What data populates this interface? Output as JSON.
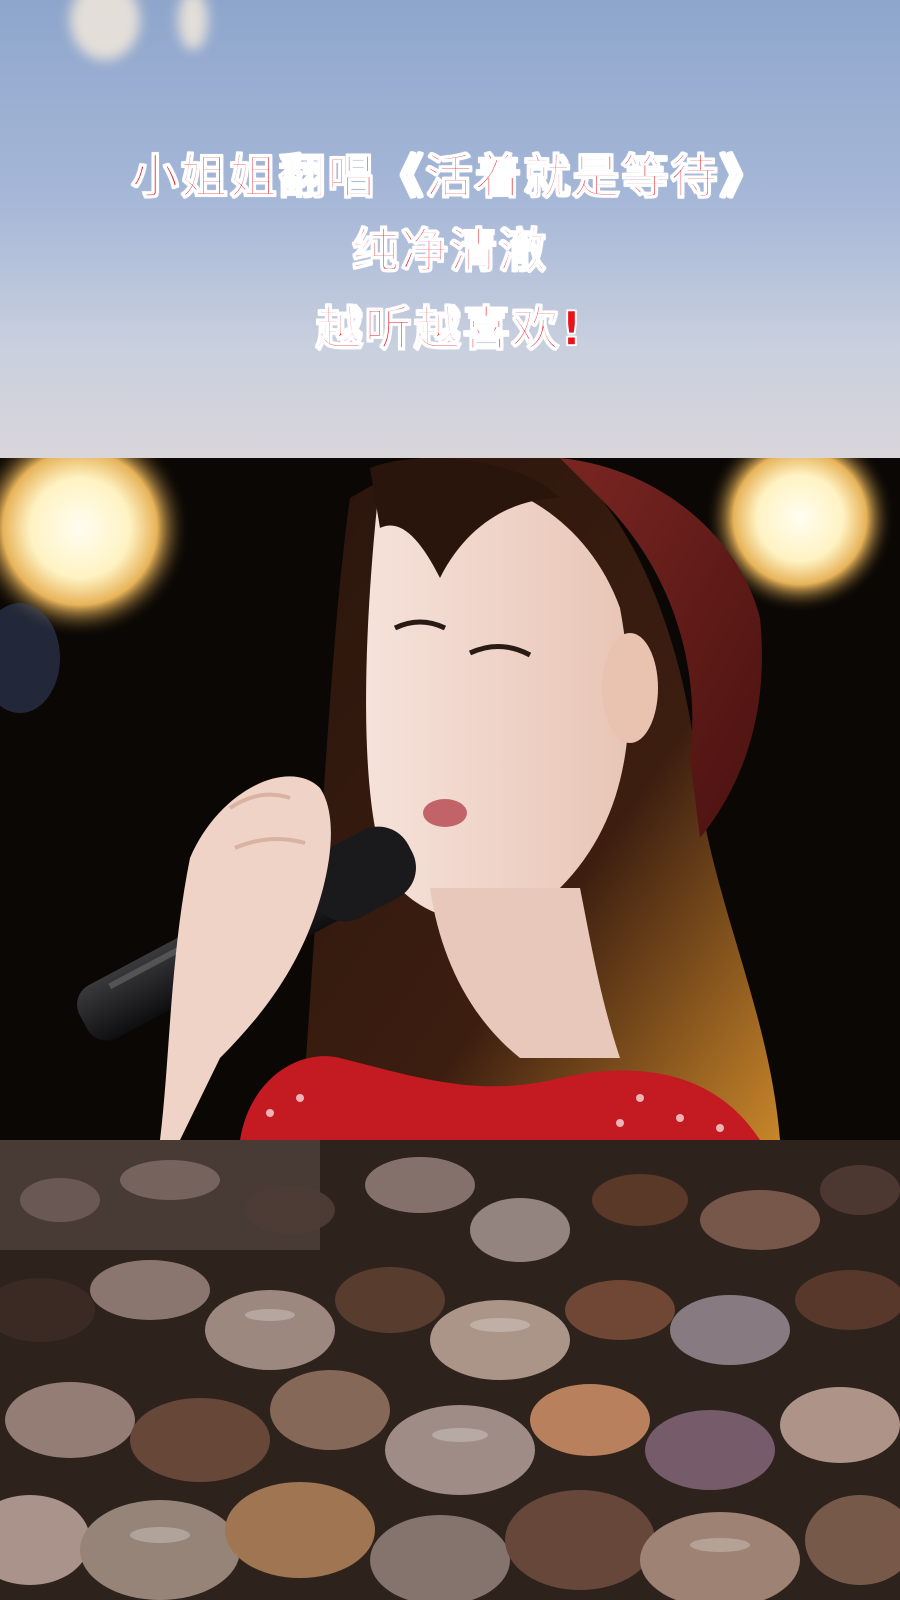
{
  "caption": {
    "line1": "小姐姐翻唱《活着就是等待》",
    "line2": "纯净清澈",
    "line3": "越听越喜欢!"
  },
  "colors": {
    "caption_fill": "#e8141c",
    "caption_stroke": "#ffffff",
    "sky_top": "#8ea6cc",
    "stage_background": "#0b0704",
    "hat": "#6e1e1e",
    "dress": "#c41a22"
  },
  "scene": {
    "top_panel": "sky with clouds",
    "middle_panel": "woman in red hat singing into microphone with stage lights",
    "bottom_panel": "wet pebbles on beach"
  }
}
